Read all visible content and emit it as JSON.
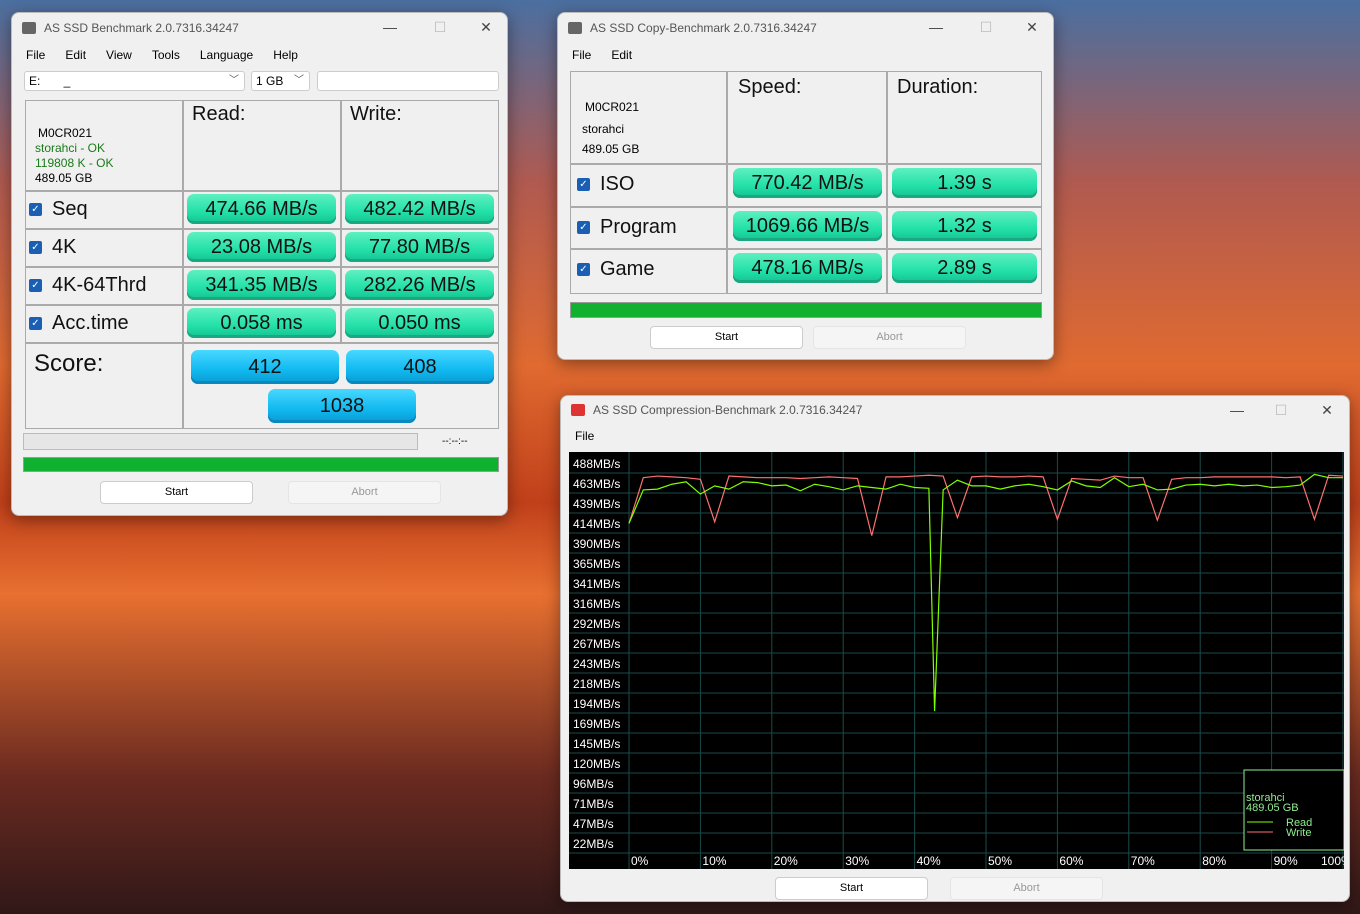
{
  "bench": {
    "title": "AS SSD Benchmark 2.0.7316.34247",
    "menu": [
      "File",
      "Edit",
      "View",
      "Tools",
      "Language",
      "Help"
    ],
    "drive": "E:       _",
    "size": "1 GB",
    "drive_info": {
      "model": "M0CR021",
      "driver": "storahci - OK",
      "align": "119808 K - OK",
      "capacity": "489.05 GB"
    },
    "read_header": "Read:",
    "write_header": "Write:",
    "rows": [
      {
        "label": "Seq",
        "read": "474.66 MB/s",
        "write": "482.42 MB/s",
        "checked": true
      },
      {
        "label": "4K",
        "read": "23.08 MB/s",
        "write": "77.80 MB/s",
        "checked": true
      },
      {
        "label": "4K-64Thrd",
        "read": "341.35 MB/s",
        "write": "282.26 MB/s",
        "checked": true
      },
      {
        "label": "Acc.time",
        "read": "0.058 ms",
        "write": "0.050 ms",
        "checked": true
      }
    ],
    "score_label": "Score:",
    "score_read": "412",
    "score_write": "408",
    "score_total": "1038",
    "time": "--:--:--",
    "progress": 100,
    "start": "Start",
    "abort": "Abort"
  },
  "copy": {
    "title": "AS SSD Copy-Benchmark 2.0.7316.34247",
    "menu": [
      "File",
      "Edit"
    ],
    "drive_info": {
      "model": "M0CR021",
      "driver": "storahci",
      "capacity": "489.05 GB"
    },
    "speed_header": "Speed:",
    "duration_header": "Duration:",
    "rows": [
      {
        "label": "ISO",
        "speed": "770.42 MB/s",
        "duration": "1.39 s",
        "checked": true
      },
      {
        "label": "Program",
        "speed": "1069.66 MB/s",
        "duration": "1.32 s",
        "checked": true
      },
      {
        "label": "Game",
        "speed": "478.16 MB/s",
        "duration": "2.89 s",
        "checked": true
      }
    ],
    "progress": 100,
    "start": "Start",
    "abort": "Abort"
  },
  "compression": {
    "title": "AS SSD Compression-Benchmark 2.0.7316.34247",
    "menu": [
      "File"
    ],
    "start": "Start",
    "abort": "Abort",
    "legend": {
      "driver": "storahci",
      "capacity": "489.05 GB"
    }
  },
  "chart_data": {
    "type": "line",
    "ylim": [
      0,
      488
    ],
    "xlim": [
      0,
      100
    ],
    "yticks": [
      "488MB/s",
      "463MB/s",
      "439MB/s",
      "414MB/s",
      "390MB/s",
      "365MB/s",
      "341MB/s",
      "316MB/s",
      "292MB/s",
      "267MB/s",
      "243MB/s",
      "218MB/s",
      "194MB/s",
      "169MB/s",
      "145MB/s",
      "120MB/s",
      "96MB/s",
      "71MB/s",
      "47MB/s",
      "22MB/s"
    ],
    "xticks": [
      "0%",
      "10%",
      "20%",
      "30%",
      "40%",
      "50%",
      "60%",
      "70%",
      "80%",
      "90%",
      "100%"
    ],
    "series": [
      {
        "name": "Read",
        "color": "#80ff00",
        "points": [
          [
            0,
            414
          ],
          [
            2,
            455
          ],
          [
            4,
            456
          ],
          [
            6,
            462
          ],
          [
            8,
            465
          ],
          [
            10,
            450
          ],
          [
            12,
            460
          ],
          [
            14,
            456
          ],
          [
            16,
            465
          ],
          [
            18,
            464
          ],
          [
            20,
            460
          ],
          [
            22,
            461
          ],
          [
            24,
            454
          ],
          [
            26,
            462
          ],
          [
            28,
            459
          ],
          [
            30,
            455
          ],
          [
            32,
            460
          ],
          [
            34,
            458
          ],
          [
            36,
            456
          ],
          [
            38,
            462
          ],
          [
            40,
            458
          ],
          [
            42,
            457
          ],
          [
            42.8,
            184
          ],
          [
            44,
            455
          ],
          [
            46,
            467
          ],
          [
            48,
            460
          ],
          [
            50,
            460
          ],
          [
            52,
            456
          ],
          [
            54,
            460
          ],
          [
            56,
            462
          ],
          [
            58,
            459
          ],
          [
            60,
            455
          ],
          [
            62,
            466
          ],
          [
            64,
            460
          ],
          [
            66,
            458
          ],
          [
            68,
            470
          ],
          [
            70,
            459
          ],
          [
            72,
            462
          ],
          [
            74,
            455
          ],
          [
            76,
            456
          ],
          [
            78,
            461
          ],
          [
            80,
            462
          ],
          [
            82,
            460
          ],
          [
            84,
            462
          ],
          [
            86,
            460
          ],
          [
            88,
            461
          ],
          [
            90,
            458
          ],
          [
            92,
            459
          ],
          [
            94,
            461
          ],
          [
            96,
            474
          ],
          [
            98,
            470
          ],
          [
            100,
            470
          ]
        ]
      },
      {
        "name": "Write",
        "color": "#ff7070",
        "points": [
          [
            0,
            414
          ],
          [
            2,
            470
          ],
          [
            4,
            472
          ],
          [
            6,
            471
          ],
          [
            8,
            470
          ],
          [
            10,
            468
          ],
          [
            12,
            416
          ],
          [
            14,
            472
          ],
          [
            16,
            471
          ],
          [
            18,
            470
          ],
          [
            20,
            470
          ],
          [
            22,
            470
          ],
          [
            24,
            469
          ],
          [
            26,
            470
          ],
          [
            28,
            471
          ],
          [
            30,
            470
          ],
          [
            32,
            469
          ],
          [
            34,
            399
          ],
          [
            36,
            471
          ],
          [
            38,
            471
          ],
          [
            40,
            472
          ],
          [
            42,
            473
          ],
          [
            44,
            472
          ],
          [
            46,
            421
          ],
          [
            48,
            471
          ],
          [
            50,
            472
          ],
          [
            52,
            471
          ],
          [
            54,
            471
          ],
          [
            56,
            472
          ],
          [
            58,
            471
          ],
          [
            60,
            419
          ],
          [
            62,
            469
          ],
          [
            64,
            468
          ],
          [
            66,
            467
          ],
          [
            68,
            472
          ],
          [
            70,
            470
          ],
          [
            72,
            470
          ],
          [
            74,
            418
          ],
          [
            76,
            468
          ],
          [
            78,
            470
          ],
          [
            80,
            470
          ],
          [
            82,
            471
          ],
          [
            84,
            471
          ],
          [
            86,
            471
          ],
          [
            88,
            471
          ],
          [
            90,
            471
          ],
          [
            92,
            470
          ],
          [
            94,
            471
          ],
          [
            96,
            419
          ],
          [
            98,
            473
          ],
          [
            100,
            472
          ]
        ]
      }
    ]
  }
}
